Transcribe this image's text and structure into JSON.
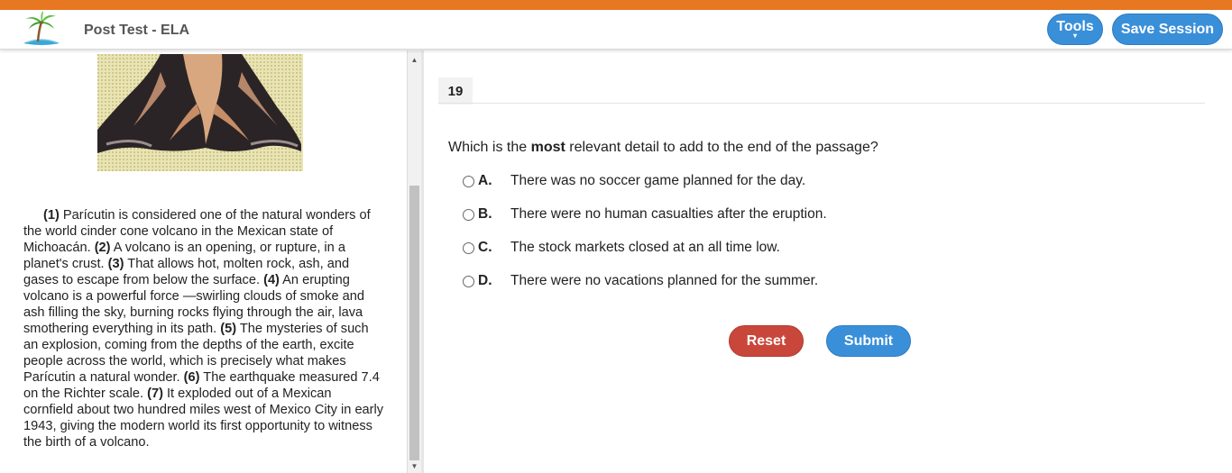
{
  "header": {
    "title": "Post Test - ELA",
    "tools_label": "Tools",
    "tools_caret": "▾",
    "save_label": "Save Session"
  },
  "scroll": {
    "up_arrow": "▲",
    "down_arrow": "▼"
  },
  "passage": {
    "sentences": [
      {
        "num": "(1)",
        "text": " Parícutin is considered one of the natural wonders of the world cinder cone volcano in the Mexican state of Michoacán. "
      },
      {
        "num": "(2)",
        "text": " A volcano is an opening, or rupture, in a planet's crust. "
      },
      {
        "num": "(3)",
        "text": " That allows hot, molten rock, ash, and gases to escape from below the surface. "
      },
      {
        "num": "(4)",
        "text": " An erupting volcano is a powerful force —swirling clouds of smoke and ash filling the sky, burning rocks flying through the air, lava smothering everything in its path. "
      },
      {
        "num": "(5)",
        "text": " The mysteries of such an explosion, coming from the depths of the earth, excite people across the world, which is precisely what makes Parícutin a natural wonder. "
      },
      {
        "num": "(6)",
        "text": " The earthquake measured 7.4 on the Richter scale. "
      },
      {
        "num": "(7)",
        "text": " It exploded out of a Mexican cornfield about two hundred miles west of Mexico City in early 1943, giving the modern world its first opportunity to witness the birth of a volcano."
      }
    ]
  },
  "question": {
    "number": "19",
    "prompt_before": "Which is the ",
    "prompt_bold": "most",
    "prompt_after": " relevant detail to add to the end of the passage?",
    "options": [
      {
        "letter": "A.",
        "text": "There was no soccer game planned for the day."
      },
      {
        "letter": "B.",
        "text": "There were no human casualties after the eruption."
      },
      {
        "letter": "C.",
        "text": "The stock markets closed at an all time low."
      },
      {
        "letter": "D.",
        "text": "There were no vacations planned for the summer."
      }
    ]
  },
  "actions": {
    "reset_label": "Reset",
    "submit_label": "Submit"
  },
  "colors": {
    "accent_bar": "#e87722",
    "primary_button": "#3a8fd9",
    "reset_button": "#c9473a"
  }
}
